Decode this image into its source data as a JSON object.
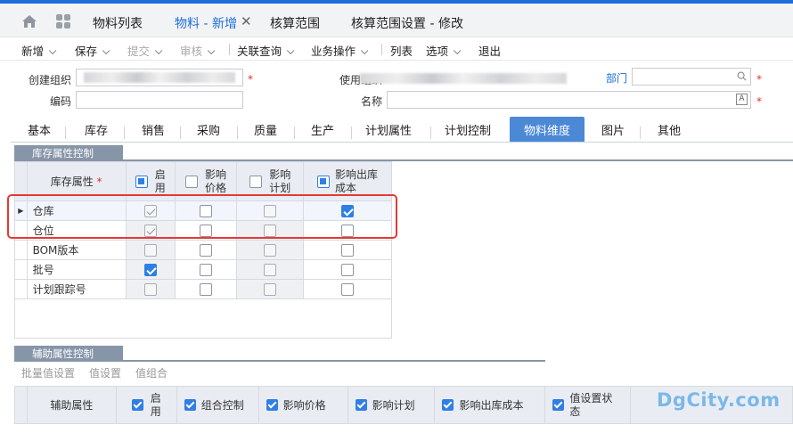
{
  "tabs": [
    {
      "label": "物料列表"
    },
    {
      "label": "物料 - 新增"
    },
    {
      "label": "核算范围"
    },
    {
      "label": "核算范围设置 - 修改"
    }
  ],
  "toolbar": {
    "new": "新增",
    "save": "保存",
    "submit": "提交",
    "audit": "审核",
    "linked_query": "关联查询",
    "business_ops": "业务操作",
    "list": "列表",
    "options": "选项",
    "exit": "退出"
  },
  "form": {
    "create_org_label": "创建组织",
    "use_org_label": "使用组织",
    "department_link": "部门",
    "code_label": "编码",
    "name_label": "名称",
    "required_mark": "*"
  },
  "page_tabs": [
    "基本",
    "库存",
    "销售",
    "采购",
    "质量",
    "生产",
    "计划属性",
    "计划控制",
    "物料维度",
    "图片",
    "其他"
  ],
  "inventory_section": {
    "title": "库存属性控制",
    "headers": {
      "attr": "库存属性",
      "enable_1": "启",
      "enable_2": "用",
      "price_1": "影响",
      "price_2": "价格",
      "plan_1": "影响",
      "plan_2": "计划",
      "cost_1": "影响出库",
      "cost_2": "成本"
    },
    "rows": [
      {
        "name": "仓库",
        "enable": "checked-dim",
        "price": "unchecked",
        "plan": "unchecked",
        "cost": "checked"
      },
      {
        "name": "仓位",
        "enable": "checked-dim",
        "price": "unchecked",
        "plan": "unchecked",
        "cost": "unchecked"
      },
      {
        "name": "BOM版本",
        "enable": "unchecked",
        "price": "unchecked",
        "plan": "unchecked",
        "cost": "unchecked"
      },
      {
        "name": "批号",
        "enable": "checked",
        "price": "unchecked",
        "plan": "unchecked",
        "cost": "unchecked"
      },
      {
        "name": "计划跟踪号",
        "enable": "unchecked",
        "price": "unchecked",
        "plan": "unchecked",
        "cost": "unchecked"
      }
    ]
  },
  "aux_section": {
    "title": "辅助属性控制",
    "toolbar": [
      "批量值设置",
      "值设置",
      "值组合"
    ],
    "headers": {
      "attr": "辅助属性",
      "enable_1": "启",
      "enable_2": "用",
      "combo": "组合控制",
      "price": "影响价格",
      "plan": "影响计划",
      "cost": "影响出库成本",
      "valset_1": "值设置状",
      "valset_2": "态"
    }
  },
  "watermark": "DgCity.com"
}
